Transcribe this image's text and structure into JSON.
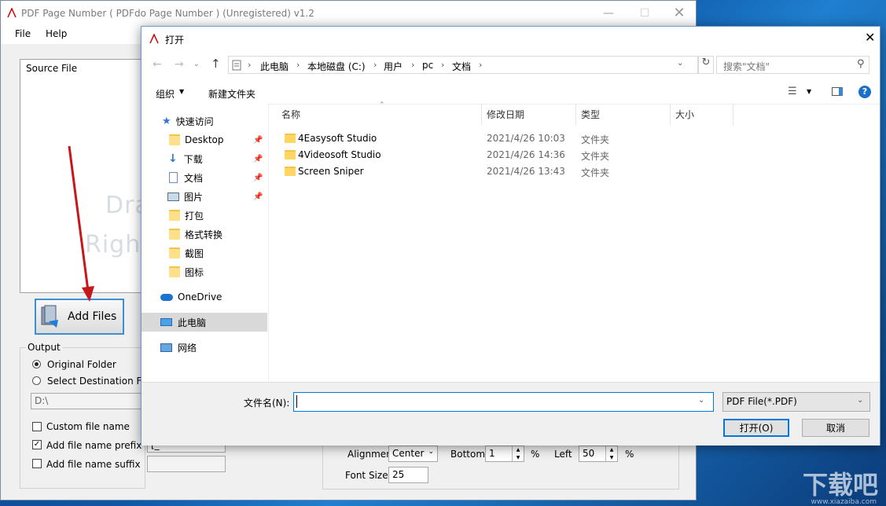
{
  "app": {
    "title": "PDF Page Number ( PDFdo Page Number )  (Unregistered) v1.2",
    "menu": [
      "File",
      "Help"
    ],
    "source_label": "Source File",
    "ghost_line1": "Dra",
    "ghost_line2": "Righ",
    "add_files": "Add Files",
    "output": {
      "label": "Output",
      "original_folder": "Original Folder",
      "select_dest": "Select Destination Fol",
      "path_value": "D:\\"
    },
    "options": {
      "custom_file_name": "Custom file name",
      "add_prefix": "Add file name prefix",
      "prefix_value": "[_",
      "add_suffix": "Add file name suffix"
    },
    "format": {
      "alignment_label": "Alignmen",
      "alignment_value": "Center",
      "bottom_label": "Bottom",
      "bottom_value": "1",
      "bottom_unit": "%",
      "left_label": "Left",
      "left_value": "50",
      "left_unit": "%",
      "font_size_label": "Font Size",
      "font_size_value": "25"
    }
  },
  "dialog": {
    "title": "打开",
    "breadcrumb": [
      "此电脑",
      "本地磁盘 (C:)",
      "用户",
      "pc",
      "文档"
    ],
    "search_placeholder": "搜索\"文档\"",
    "toolbar": {
      "organize": "组织",
      "new_folder": "新建文件夹"
    },
    "nav": [
      {
        "label": "快速访问",
        "icon": "star-icon",
        "pin": false
      },
      {
        "label": "Desktop",
        "icon": "folder-icon",
        "pin": true
      },
      {
        "label": "下载",
        "icon": "download-icon",
        "pin": true
      },
      {
        "label": "文档",
        "icon": "document-icon",
        "pin": true
      },
      {
        "label": "图片",
        "icon": "pictures-icon",
        "pin": true
      },
      {
        "label": "打包",
        "icon": "folder-icon",
        "pin": false
      },
      {
        "label": "格式转换",
        "icon": "folder-icon",
        "pin": false
      },
      {
        "label": "截图",
        "icon": "folder-icon",
        "pin": false
      },
      {
        "label": "图标",
        "icon": "folder-icon",
        "pin": false
      },
      {
        "label": "OneDrive",
        "icon": "cloud-icon",
        "pin": false
      },
      {
        "label": "此电脑",
        "icon": "computer-icon",
        "pin": false
      },
      {
        "label": "网络",
        "icon": "network-icon",
        "pin": false
      }
    ],
    "columns": [
      "名称",
      "修改日期",
      "类型",
      "大小"
    ],
    "files": [
      {
        "name": "4Easysoft Studio",
        "date": "2021/4/26 10:03",
        "type": "文件夹"
      },
      {
        "name": "4Videosoft Studio",
        "date": "2021/4/26 14:36",
        "type": "文件夹"
      },
      {
        "name": "Screen Sniper",
        "date": "2021/4/26 13:43",
        "type": "文件夹"
      }
    ],
    "filename_label": "文件名(N):",
    "filename_value": "",
    "filetype": "PDF File(*.PDF)",
    "open_button": "打开(O)",
    "cancel_button": "取消"
  },
  "watermark": {
    "text": "下载吧",
    "url_text": "www.xiazaiba.com"
  },
  "colors": {
    "accent": "#0078d7",
    "arrow": "#c8161d",
    "folder": "#ffd661",
    "selected": "#d9d9d9"
  }
}
